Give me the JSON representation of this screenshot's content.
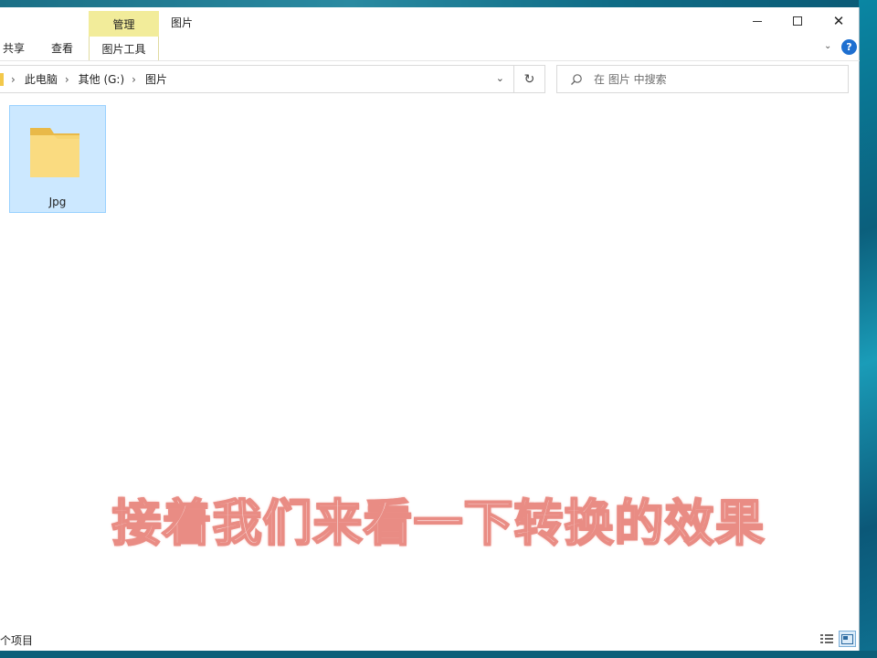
{
  "window": {
    "title": "图片",
    "manage_tab": "管理",
    "ribbon_tabs": {
      "share": "共享",
      "view": "查看",
      "picture_tools": "图片工具"
    }
  },
  "address_bar": {
    "crumbs": [
      "此电脑",
      "其他 (G:)",
      "图片"
    ]
  },
  "search": {
    "placeholder": "在 图片 中搜索"
  },
  "folders": [
    {
      "name": "Jpg",
      "selected": true
    }
  ],
  "caption": "接着我们来看一下转换的效果",
  "status": {
    "item_count": "个项目"
  },
  "colors": {
    "selection": "#cce8ff",
    "manage_tab": "#f2ec9a",
    "accent": "#1e6fd0",
    "caption_stroke": "#e98c84"
  }
}
